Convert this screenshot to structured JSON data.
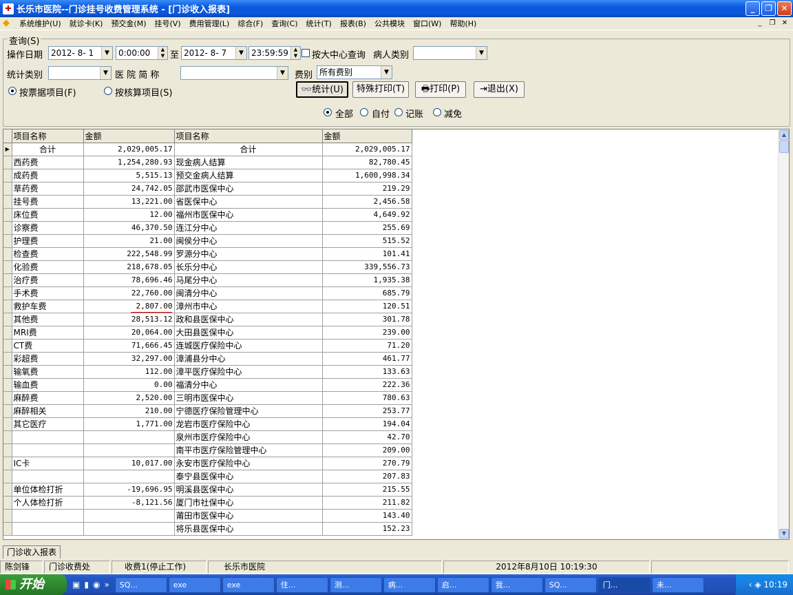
{
  "window": {
    "title": "长乐市医院--门诊挂号收费管理系统 - [门诊收入报表]"
  },
  "menu": [
    "系统维护(U)",
    "就诊卡(K)",
    "预交金(M)",
    "挂号(V)",
    "费用管理(L)",
    "综合(F)",
    "查询(C)",
    "统计(T)",
    "报表(B)",
    "公共模块",
    "窗口(W)",
    "帮助(H)"
  ],
  "query": {
    "group_label": "查询(S)",
    "date_label": "操作日期",
    "start_date": "2012- 8- 1",
    "start_time": "0:00:00",
    "to_label": "至",
    "end_date": "2012- 8- 7",
    "end_time": "23:59:59",
    "center_check_label": "按大中心查询",
    "patient_type_label": "病人类别",
    "patient_type_value": "",
    "stat_type_label": "统计类别",
    "stat_type_value": "",
    "hospital_label": "医 院 简 称",
    "hospital_value": "",
    "fee_label": "费别",
    "fee_value": "所有费别",
    "radio_ticket": "按票据项目(F)",
    "radio_account": "按核算项目(S)",
    "radio_all": "全部",
    "radio_self": "自付",
    "radio_credit": "记账",
    "radio_waive": "减免"
  },
  "buttons": {
    "stat": "统计(U)",
    "special_print": "特殊打印(T)",
    "print": "打印(P)",
    "exit": "退出(X)"
  },
  "grid": {
    "headers": [
      "项目名称",
      "金额",
      "项目名称",
      "金额"
    ],
    "rows": [
      [
        "合计",
        "2,029,005.17",
        "合计",
        "2,029,005.17"
      ],
      [
        "西药费",
        "1,254,280.93",
        "现金病人结算",
        "82,780.45"
      ],
      [
        "成药费",
        "5,515.13",
        "预交金病人结算",
        "1,600,998.34"
      ],
      [
        "草药费",
        "24,742.05",
        "邵武市医保中心",
        "219.29"
      ],
      [
        "挂号费",
        "13,221.00",
        "省医保中心",
        "2,456.58"
      ],
      [
        "床位费",
        "12.00",
        "福州市医保中心",
        "4,649.92"
      ],
      [
        "诊察费",
        "46,370.50",
        "连江分中心",
        "255.69"
      ],
      [
        "护理费",
        "21.00",
        "闽侯分中心",
        "515.52"
      ],
      [
        "检查费",
        "222,548.99",
        "罗源分中心",
        "101.41"
      ],
      [
        "化验费",
        "218,678.05",
        "长乐分中心",
        "339,556.73"
      ],
      [
        "治疗费",
        "78,696.46",
        "马尾分中心",
        "1,935.38"
      ],
      [
        "手术费",
        "22,760.00",
        "闽清分中心",
        "685.79"
      ],
      [
        "救护车费",
        "2,807.00",
        "漳州市中心",
        "120.51"
      ],
      [
        "其他费",
        "28,513.12",
        "政和县医保中心",
        "301.78"
      ],
      [
        "MRI费",
        "20,064.00",
        "大田县医保中心",
        "239.00"
      ],
      [
        "CT费",
        "71,666.45",
        "连城医疗保险中心",
        "71.20"
      ],
      [
        "彩超费",
        "32,297.00",
        "漳浦县分中心",
        "461.77"
      ],
      [
        "输氧费",
        "112.00",
        "漳平医疗保险中心",
        "133.63"
      ],
      [
        "输血费",
        "0.00",
        "福清分中心",
        "222.36"
      ],
      [
        "麻醉费",
        "2,520.00",
        "三明市医保中心",
        "780.63"
      ],
      [
        "麻醉相关",
        "210.00",
        "宁德医疗保险管理中心",
        "253.77"
      ],
      [
        "其它医疗",
        "1,771.00",
        "龙岩市医疗保险中心",
        "194.04"
      ],
      [
        "",
        "",
        "泉州市医疗保险中心",
        "42.70"
      ],
      [
        "",
        "",
        "南平市医疗保险管理中心",
        "209.00"
      ],
      [
        "IC卡",
        "10,017.00",
        "永安市医疗保险中心",
        "270.79"
      ],
      [
        "",
        "",
        "泰宁县医保中心",
        "207.83"
      ],
      [
        "单位体检打折",
        "-19,696.95",
        "明溪县医保中心",
        "215.55"
      ],
      [
        "个人体检打折",
        "-8,121.56",
        "厦门市社保中心",
        "211.82"
      ],
      [
        "",
        "",
        "莆田市医保中心",
        "143.40"
      ],
      [
        "",
        "",
        "将乐县医保中心",
        "152.23"
      ]
    ]
  },
  "tab_label": "门诊收入报表",
  "status": {
    "user": "陈剑锋",
    "dept": "门诊收费处",
    "station": "收费1(停止工作)",
    "hospital": "长乐市医院",
    "datetime": "2012年8月10日 10:19:30"
  },
  "taskbar": {
    "start": "开始",
    "items": [
      "SQ...",
      "exe",
      "exe",
      "住...",
      "测...",
      "病...",
      "启...",
      "我...",
      "SQ...",
      "门...",
      "未..."
    ],
    "clock": "10:19"
  }
}
